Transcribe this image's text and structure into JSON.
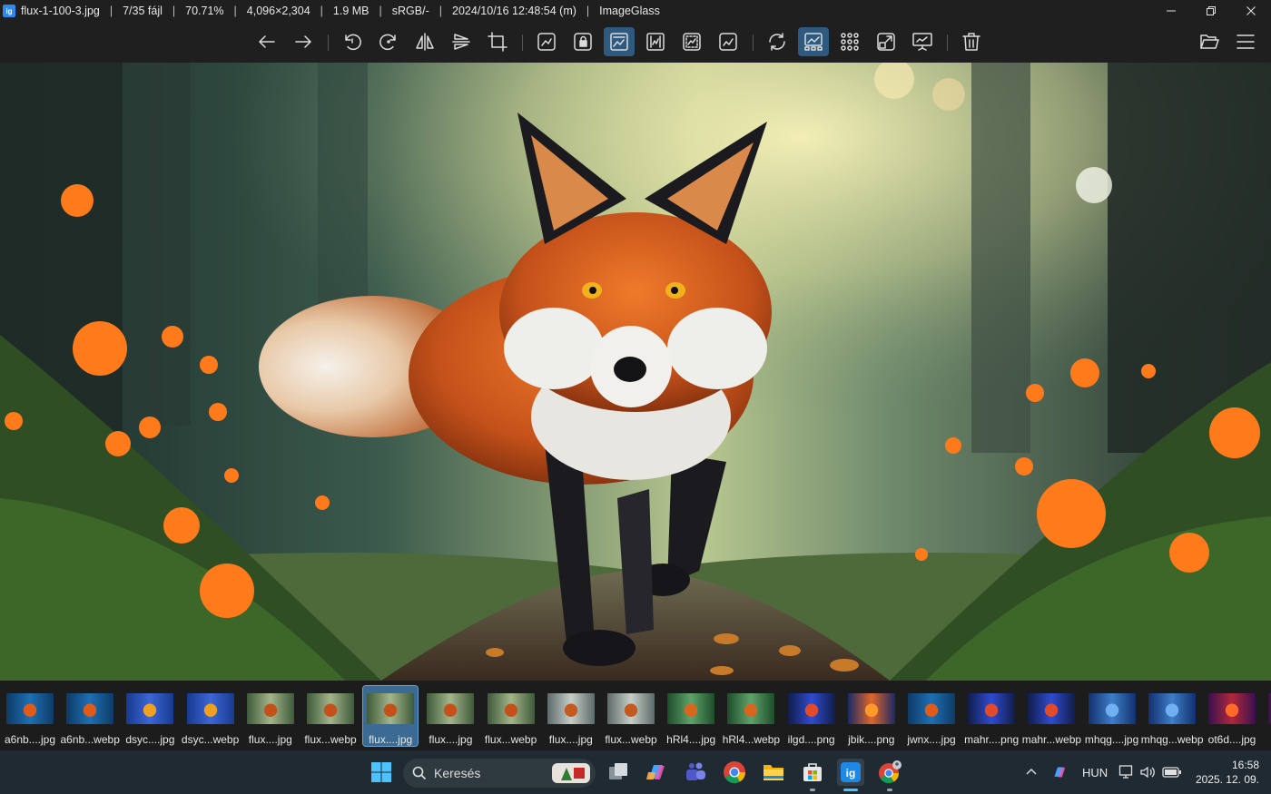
{
  "window": {
    "file_name": "flux-1-100-3.jpg",
    "file_index": "7/35 fájl",
    "zoom": "70.71%",
    "dimensions": "4,096×2,304",
    "file_size": "1.9 MB",
    "color_profile": "sRGB/-",
    "modified": "2024/10/16 12:48:54 (m)",
    "app_name": "ImageGlass",
    "app_icon_text": "ig"
  },
  "toolbar": {
    "buttons": [
      {
        "name": "previous-image-button",
        "icon": "arrow-left-icon"
      },
      {
        "name": "next-image-button",
        "icon": "arrow-right-icon"
      },
      {
        "name": "rotate-left-button",
        "icon": "rotate-left-icon"
      },
      {
        "name": "rotate-right-button",
        "icon": "rotate-right-icon"
      },
      {
        "name": "flip-horizontal-button",
        "icon": "flip-horizontal-icon"
      },
      {
        "name": "flip-vertical-button",
        "icon": "flip-vertical-icon"
      },
      {
        "name": "crop-button",
        "icon": "crop-icon"
      },
      {
        "name": "auto-zoom-button",
        "icon": "auto-zoom-icon"
      },
      {
        "name": "lock-zoom-button",
        "icon": "lock-zoom-icon"
      },
      {
        "name": "scale-to-width-button",
        "icon": "scale-to-width-icon",
        "active": true
      },
      {
        "name": "scale-to-height-button",
        "icon": "scale-to-height-icon"
      },
      {
        "name": "scale-to-fit-button",
        "icon": "scale-to-fit-icon"
      },
      {
        "name": "scale-to-fill-button",
        "icon": "scale-to-fill-icon"
      },
      {
        "name": "refresh-button",
        "icon": "refresh-icon"
      },
      {
        "name": "gallery-button",
        "icon": "gallery-icon",
        "active": true
      },
      {
        "name": "checkerboard-button",
        "icon": "grid-dots-icon"
      },
      {
        "name": "fullscreen-button",
        "icon": "fullscreen-icon"
      },
      {
        "name": "slideshow-button",
        "icon": "slideshow-icon"
      },
      {
        "name": "delete-button",
        "icon": "trash-icon"
      },
      {
        "name": "open-file-button",
        "icon": "folder-open-icon"
      },
      {
        "name": "main-menu-button",
        "icon": "hamburger-menu-icon"
      }
    ]
  },
  "thumbnails": [
    {
      "label": "a6nb....jpg",
      "theme": "fox-blue"
    },
    {
      "label": "a6nb...webp",
      "theme": "fox-blue"
    },
    {
      "label": "dsyc....jpg",
      "theme": "monk"
    },
    {
      "label": "dsyc...webp",
      "theme": "monk"
    },
    {
      "label": "flux....jpg",
      "theme": "fox-forest"
    },
    {
      "label": "flux...webp",
      "theme": "fox-forest"
    },
    {
      "label": "flux....jpg",
      "theme": "fox-forest",
      "selected": true
    },
    {
      "label": "flux....jpg",
      "theme": "fox-forest"
    },
    {
      "label": "flux...webp",
      "theme": "fox-forest"
    },
    {
      "label": "flux....jpg",
      "theme": "fox-mist"
    },
    {
      "label": "flux...webp",
      "theme": "fox-mist"
    },
    {
      "label": "hRl4....jpg",
      "theme": "fox-green"
    },
    {
      "label": "hRl4...webp",
      "theme": "fox-green"
    },
    {
      "label": "ilgd....png",
      "theme": "fox-night"
    },
    {
      "label": "jbik....png",
      "theme": "fox-fire"
    },
    {
      "label": "jwnx....jpg",
      "theme": "fox-blue"
    },
    {
      "label": "mahr....png",
      "theme": "fox-night"
    },
    {
      "label": "mahr...webp",
      "theme": "fox-night"
    },
    {
      "label": "mhqg....jpg",
      "theme": "monk-blue"
    },
    {
      "label": "mhqg...webp",
      "theme": "monk-blue"
    },
    {
      "label": "ot6d....jpg",
      "theme": "fox-red"
    },
    {
      "label": "ot",
      "theme": "fox-red"
    }
  ],
  "taskbar": {
    "search_placeholder": "Keresés",
    "apps": [
      "windows-start-icon",
      "task-view-icon",
      "copilot-icon",
      "teams-icon",
      "chrome-icon",
      "file-explorer-icon",
      "microsoft-store-icon",
      "imageglass-icon",
      "chrome-profile-icon"
    ],
    "language": "HUN",
    "time": "16:58",
    "date": "2025. 12. 09."
  },
  "colors": {
    "accent": "#2f5a80",
    "taskbar_bg": "#202a33",
    "titlebar_bg": "#1f1f1f",
    "selected_thumb": "#3b6a92"
  }
}
